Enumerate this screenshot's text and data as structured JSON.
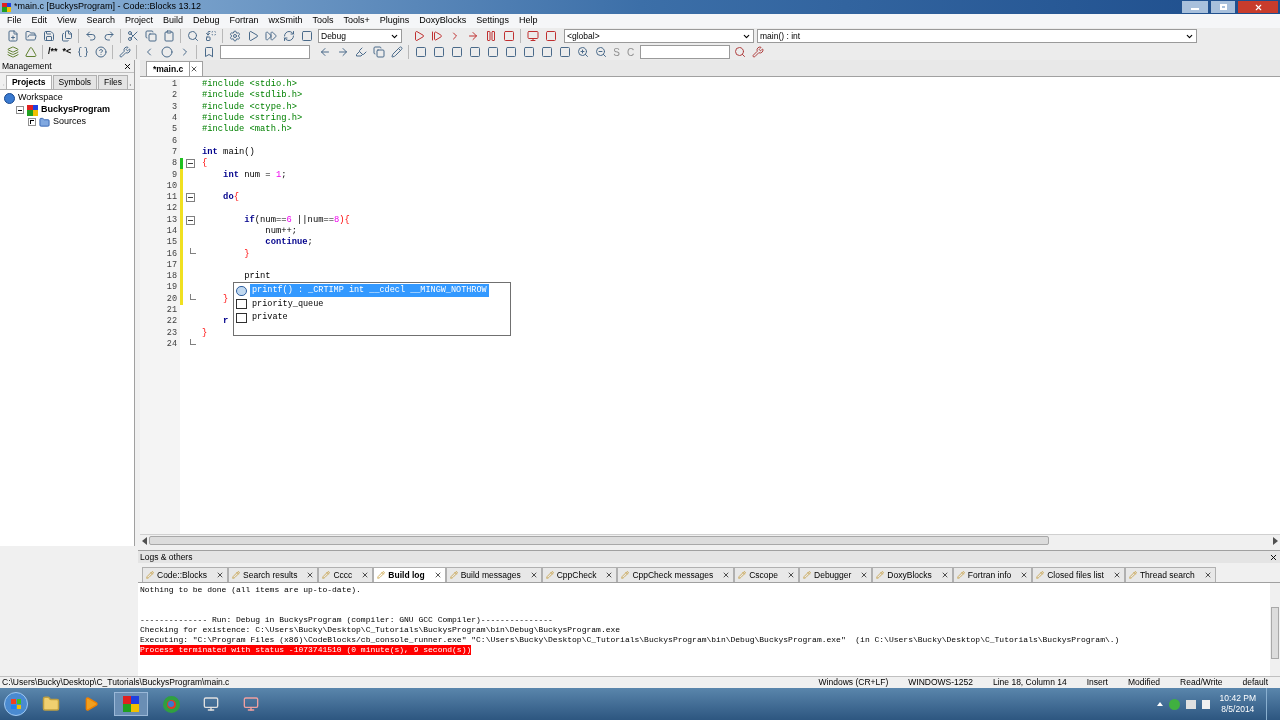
{
  "window": {
    "title": "*main.c [BuckysProgram] - Code::Blocks 13.12"
  },
  "menu": [
    "File",
    "Edit",
    "View",
    "Search",
    "Project",
    "Build",
    "Debug",
    "Fortran",
    "wxSmith",
    "Tools",
    "Tools+",
    "Plugins",
    "DoxyBlocks",
    "Settings",
    "Help"
  ],
  "toolbar": {
    "build_target": "Debug",
    "scope": "<global>",
    "function": "main() : int",
    "comment_buttons": [
      "/**",
      "*<"
    ],
    "letter_buttons": [
      "S",
      "C"
    ]
  },
  "management": {
    "title": "Management",
    "tabs": [
      {
        "label": "Projects",
        "selected": true
      },
      {
        "label": "Symbols",
        "selected": false
      },
      {
        "label": "Files",
        "selected": false
      }
    ],
    "tree": [
      {
        "label": "Workspace",
        "children": [
          {
            "label": "BuckysProgram",
            "active": true,
            "expanded": true,
            "children": [
              {
                "label": "Sources",
                "active": false,
                "expanded": false
              }
            ]
          }
        ]
      }
    ]
  },
  "editor": {
    "tabs": [
      {
        "label": "*main.c",
        "selected": true
      }
    ],
    "lines": [
      {
        "number": "1",
        "tokens": [
          {
            "text": "#include <stdio.h>",
            "kind": "preprocessor"
          }
        ]
      },
      {
        "number": "2",
        "tokens": [
          {
            "text": "#include <stdlib.h>",
            "kind": "preprocessor"
          }
        ]
      },
      {
        "number": "3",
        "tokens": [
          {
            "text": "#include <ctype.h>",
            "kind": "preprocessor"
          }
        ]
      },
      {
        "number": "4",
        "tokens": [
          {
            "text": "#include <string.h>",
            "kind": "preprocessor"
          }
        ]
      },
      {
        "number": "5",
        "tokens": [
          {
            "text": "#include <math.h>",
            "kind": "preprocessor"
          }
        ]
      },
      {
        "number": "6"
      },
      {
        "number": "7",
        "tokens": [
          {
            "text": "int",
            "kind": "keyword"
          },
          {
            "text": " main()",
            "kind": "plain"
          }
        ]
      },
      {
        "number": "8",
        "fold_start": true,
        "saved_change": true,
        "tokens": [
          {
            "text": "{",
            "kind": "operator"
          }
        ]
      },
      {
        "number": "9",
        "unsaved_change": true,
        "tokens": [
          {
            "text": "    int",
            "kind": "keyword"
          },
          {
            "text": " num = ",
            "kind": "plain"
          },
          {
            "text": "1",
            "kind": "number"
          },
          {
            "text": ";",
            "kind": "plain"
          }
        ]
      },
      {
        "number": "10",
        "unsaved_change": true
      },
      {
        "number": "11",
        "fold_start": true,
        "unsaved_change": true,
        "tokens": [
          {
            "text": "    do",
            "kind": "keyword"
          },
          {
            "text": "{",
            "kind": "operator"
          }
        ]
      },
      {
        "number": "12",
        "unsaved_change": true
      },
      {
        "number": "13",
        "fold_start": true,
        "unsaved_change": true,
        "tokens": [
          {
            "text": "        if",
            "kind": "keyword"
          },
          {
            "text": "(num==",
            "kind": "plain"
          },
          {
            "text": "6",
            "kind": "number"
          },
          {
            "text": " ||num==",
            "kind": "plain"
          },
          {
            "text": "8",
            "kind": "number"
          },
          {
            "text": "){",
            "kind": "operator"
          }
        ]
      },
      {
        "number": "14",
        "unsaved_change": true,
        "tokens": [
          {
            "text": "            num++;",
            "kind": "plain"
          }
        ]
      },
      {
        "number": "15",
        "unsaved_change": true,
        "tokens": [
          {
            "text": "            continue",
            "kind": "keyword"
          },
          {
            "text": ";",
            "kind": "plain"
          }
        ]
      },
      {
        "number": "16",
        "fold_end": true,
        "unsaved_change": true,
        "tokens": [
          {
            "text": "        }",
            "kind": "operator"
          }
        ]
      },
      {
        "number": "17",
        "unsaved_change": true
      },
      {
        "number": "18",
        "unsaved_change": true,
        "tokens": [
          {
            "text": "        print",
            "kind": "plain"
          }
        ]
      },
      {
        "number": "19",
        "unsaved_change": true
      },
      {
        "number": "20",
        "fold_end": true,
        "unsaved_change": true,
        "tokens": [
          {
            "text": "    }",
            "kind": "operator"
          }
        ]
      },
      {
        "number": "21"
      },
      {
        "number": "22",
        "tokens": [
          {
            "text": "    r",
            "kind": "keyword"
          }
        ]
      },
      {
        "number": "23",
        "tokens": [
          {
            "text": "}",
            "kind": "operator"
          }
        ]
      },
      {
        "number": "24",
        "fold_end": true
      }
    ],
    "autocomplete": {
      "items": [
        {
          "text": "printf() : _CRTIMP int __cdecl __MINGW_NOTHROW",
          "kind": "function",
          "selected": true
        },
        {
          "text": "priority_queue",
          "kind": "class",
          "selected": false
        },
        {
          "text": "private",
          "kind": "class",
          "selected": false
        }
      ]
    }
  },
  "logs": {
    "title": "Logs & others",
    "tabs": [
      {
        "label": "Code::Blocks",
        "selected": false
      },
      {
        "label": "Search results",
        "selected": false
      },
      {
        "label": "Cccc",
        "selected": false
      },
      {
        "label": "Build log",
        "selected": true
      },
      {
        "label": "Build messages",
        "selected": false
      },
      {
        "label": "CppCheck",
        "selected": false
      },
      {
        "label": "CppCheck messages",
        "selected": false
      },
      {
        "label": "Cscope",
        "selected": false
      },
      {
        "label": "Debugger",
        "selected": false
      },
      {
        "label": "DoxyBlocks",
        "selected": false
      },
      {
        "label": "Fortran info",
        "selected": false
      },
      {
        "label": "Closed files list",
        "selected": false
      },
      {
        "label": "Thread search",
        "selected": false
      }
    ],
    "lines": [
      {
        "kind": "normal",
        "text": "Nothing to be done (all items are up-to-date)."
      },
      {
        "kind": "blank"
      },
      {
        "kind": "blank"
      },
      {
        "kind": "normal",
        "text": "-------------- Run: Debug in BuckysProgram (compiler: GNU GCC Compiler)---------------"
      },
      {
        "kind": "normal",
        "text": "Checking for existence: C:\\Users\\Bucky\\Desktop\\C_Tutorials\\BuckysProgram\\bin\\Debug\\BuckysProgram.exe"
      },
      {
        "kind": "normal",
        "text": "Executing: \"C:\\Program Files (x86)\\CodeBlocks/cb_console_runner.exe\" \"C:\\Users\\Bucky\\Desktop\\C_Tutorials\\BuckysProgram\\bin\\Debug\\BuckysProgram.exe\"  (in C:\\Users\\Bucky\\Desktop\\C_Tutorials\\BuckysProgram\\.)"
      },
      {
        "kind": "error",
        "text": "Process terminated with status -1073741510 (0 minute(s), 9 second(s))"
      }
    ]
  },
  "status_bar": [
    "C:\\Users\\Bucky\\Desktop\\C_Tutorials\\BuckysProgram\\main.c",
    "Windows (CR+LF)",
    "WINDOWS-1252",
    "Line 18, Column 14",
    "Insert",
    "Modified",
    "Read/Write",
    "default"
  ],
  "taskbar": {
    "time": "10:42 PM",
    "date": "8/5/2014"
  }
}
